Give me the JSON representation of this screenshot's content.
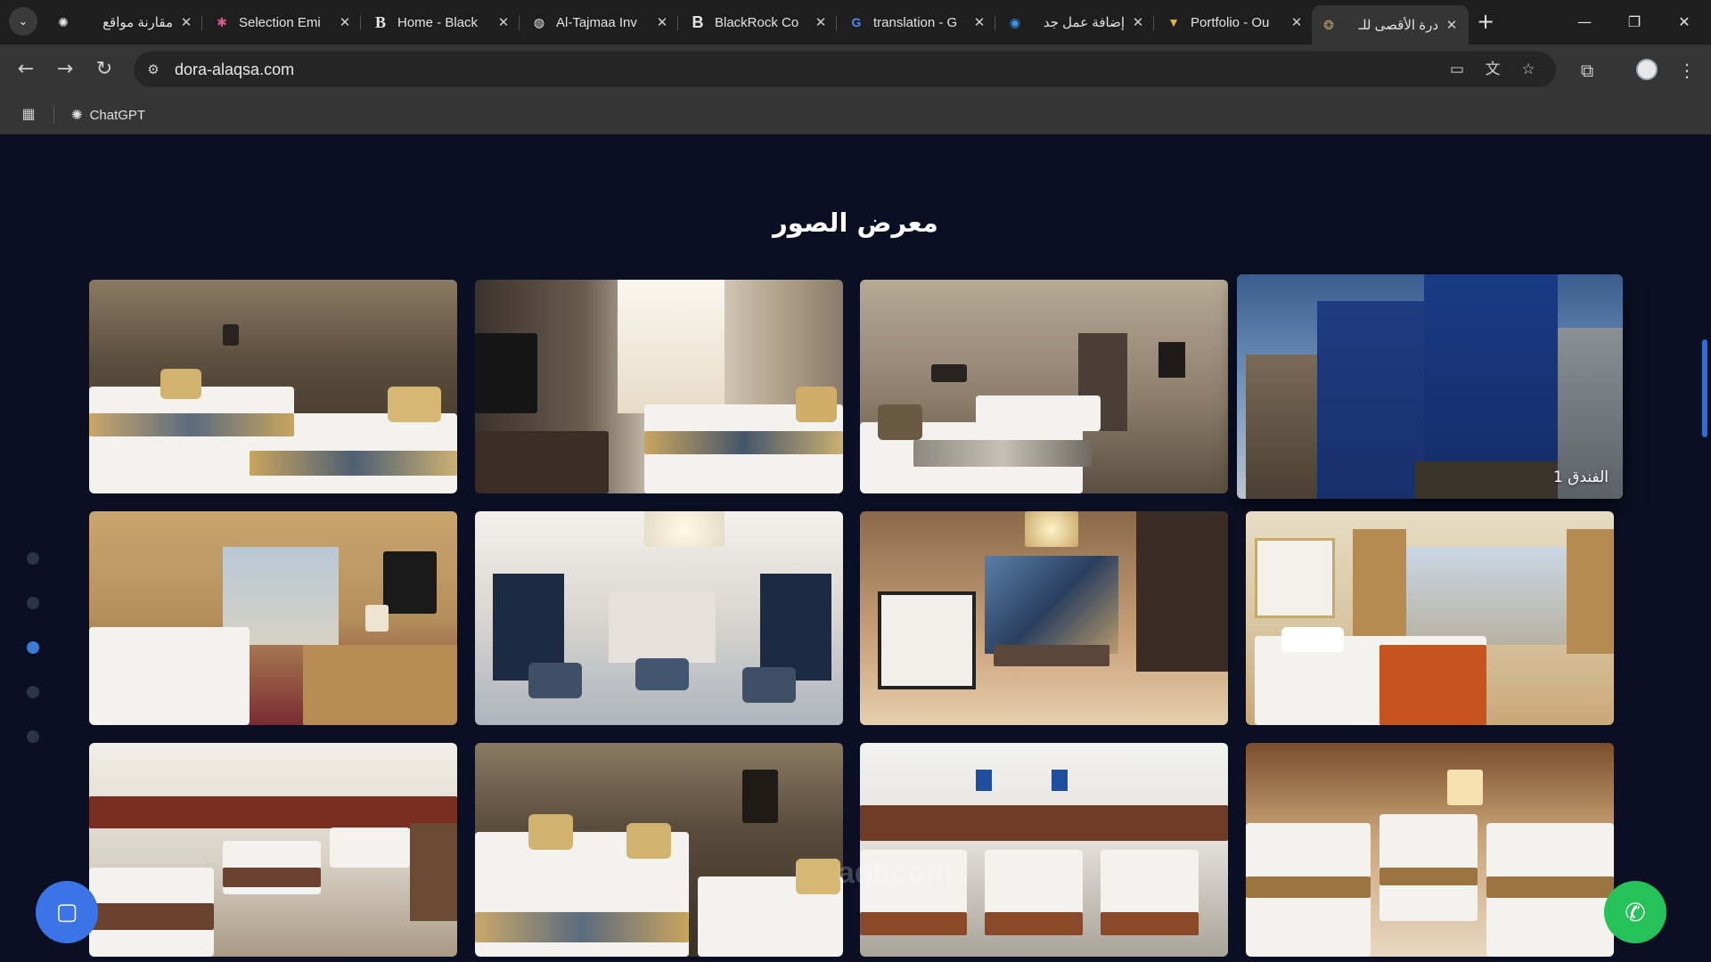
{
  "browser": {
    "tabs": [
      {
        "title": "مقارنة مواقع",
        "icon": "chatgpt-icon",
        "rtl": true
      },
      {
        "title": "Selection Emi",
        "icon": "dribbble-icon",
        "rtl": false
      },
      {
        "title": "Home - Black",
        "icon": "b-logo-icon",
        "rtl": false
      },
      {
        "title": "Al-Tajmaa Inv",
        "icon": "globe-icon",
        "rtl": false
      },
      {
        "title": "BlackRock Co",
        "icon": "b-logo-icon",
        "rtl": false
      },
      {
        "title": "translation - G",
        "icon": "google-icon",
        "rtl": false
      },
      {
        "title": "إضافة عمل جد",
        "icon": "circle-icon",
        "rtl": true
      },
      {
        "title": "Portfolio - Ou",
        "icon": "portfolio-icon",
        "rtl": false
      },
      {
        "title": "درة الأقصى للـ",
        "icon": "site-logo-icon",
        "rtl": true,
        "active": true
      }
    ],
    "url": "dora-alaqsa.com",
    "bookmarks": [
      {
        "label": "ChatGPT",
        "icon": "chatgpt-icon"
      }
    ]
  },
  "page": {
    "gallery_title": "معرض الصور",
    "featured_caption": "الفندق 1",
    "section_dots": 5,
    "active_dot": 3,
    "watermark": "aql.com"
  },
  "colors": {
    "page_bg": "#0a0f24",
    "accent_blue": "#3a7bd5",
    "whatsapp_green": "#25c25a",
    "chat_blue": "#3b74e6"
  }
}
